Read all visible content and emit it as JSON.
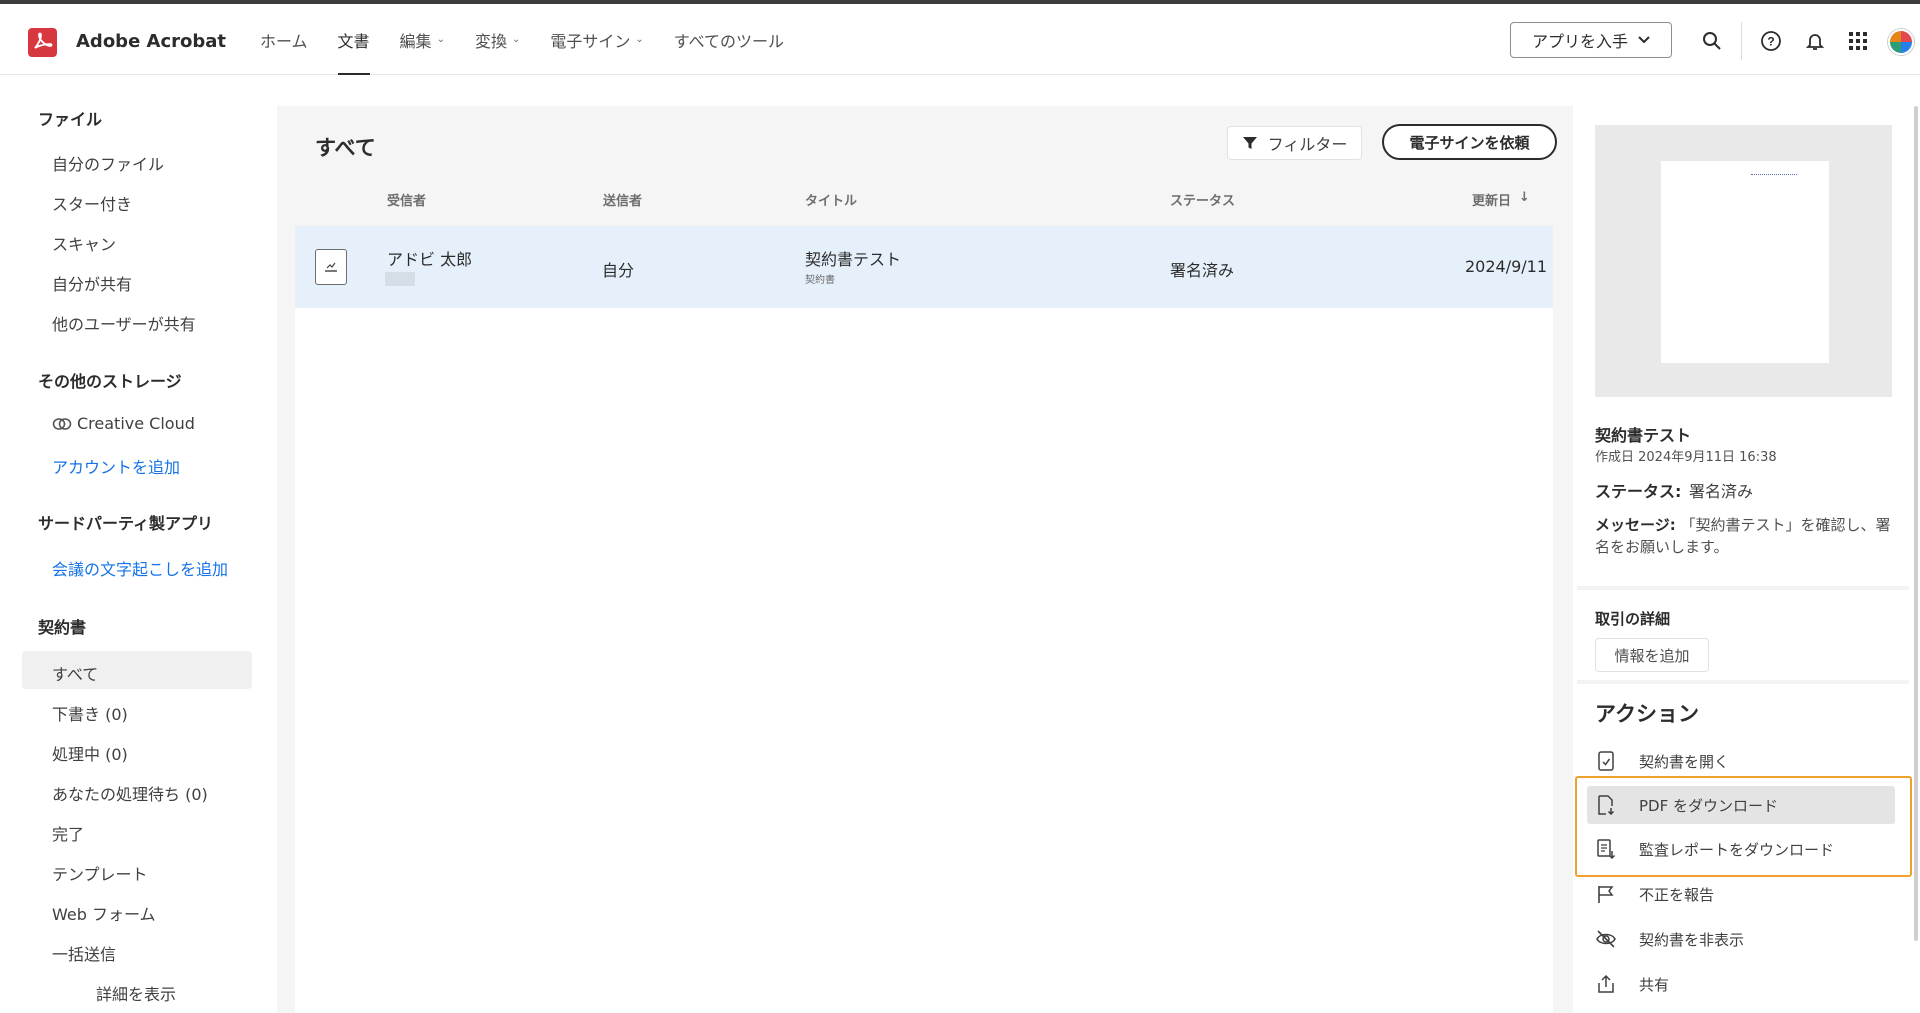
{
  "header": {
    "app_name": "Adobe Acrobat",
    "nav": [
      {
        "label": "ホーム",
        "dropdown": false,
        "active": false
      },
      {
        "label": "文書",
        "dropdown": false,
        "active": true
      },
      {
        "label": "編集",
        "dropdown": true,
        "active": false
      },
      {
        "label": "変換",
        "dropdown": true,
        "active": false
      },
      {
        "label": "電子サイン",
        "dropdown": true,
        "active": false
      },
      {
        "label": "すべてのツール",
        "dropdown": false,
        "active": false
      }
    ],
    "get_app_label": "アプリを入手",
    "icons": [
      "search-icon",
      "help-icon",
      "bell-icon",
      "apps-grid-icon",
      "avatar"
    ]
  },
  "sidebar": {
    "files_title": "ファイル",
    "files": [
      "自分のファイル",
      "スター付き",
      "スキャン",
      "自分が共有",
      "他のユーザーが共有"
    ],
    "storage_title": "その他のストレージ",
    "creative_cloud": "Creative Cloud",
    "add_account": "アカウントを追加",
    "third_party_title": "サードパーティ製アプリ",
    "add_transcription": "会議の文字起こしを追加",
    "agreements_title": "契約書",
    "agreements": [
      "すべて",
      "下書き (0)",
      "処理中 (0)",
      "あなたの処理待ち (0)",
      "完了",
      "テンプレート",
      "Web フォーム",
      "一括送信"
    ],
    "show_details": "詳細を表示"
  },
  "main": {
    "title": "すべて",
    "filter_label": "フィルター",
    "request_sign_label": "電子サインを依頼",
    "columns": {
      "recipient": "受信者",
      "sender": "送信者",
      "title": "タイトル",
      "status": "ステータス",
      "updated": "更新日"
    },
    "rows": [
      {
        "recipient": "アドビ 太郎",
        "sender": "自分",
        "title": "契約書テスト",
        "subtitle": "契約書",
        "status": "署名済み",
        "updated": "2024/9/11"
      }
    ]
  },
  "details": {
    "title": "契約書テスト",
    "created": "作成日 2024年9月11日 16:38",
    "status_label": "ステータス:",
    "status_value": "署名済み",
    "message_label": "メッセージ:",
    "message_value": "「契約書テスト」を確認し、署名をお願いします。",
    "deal_title": "取引の詳細",
    "add_info": "情報を追加",
    "actions_title": "アクション",
    "actions": [
      {
        "label": "契約書を開く",
        "icon": "open-document-icon"
      },
      {
        "label": "PDF をダウンロード",
        "icon": "pdf-download-icon"
      },
      {
        "label": "監査レポートをダウンロード",
        "icon": "report-download-icon"
      },
      {
        "label": "不正を報告",
        "icon": "flag-icon"
      },
      {
        "label": "契約書を非表示",
        "icon": "hide-eye-icon"
      },
      {
        "label": "共有",
        "icon": "share-icon"
      }
    ]
  },
  "colors": {
    "accent_link": "#1473e6",
    "brand_red": "#d7373f",
    "highlight": "#f0a02c",
    "row_selected": "#e5f0fb"
  }
}
